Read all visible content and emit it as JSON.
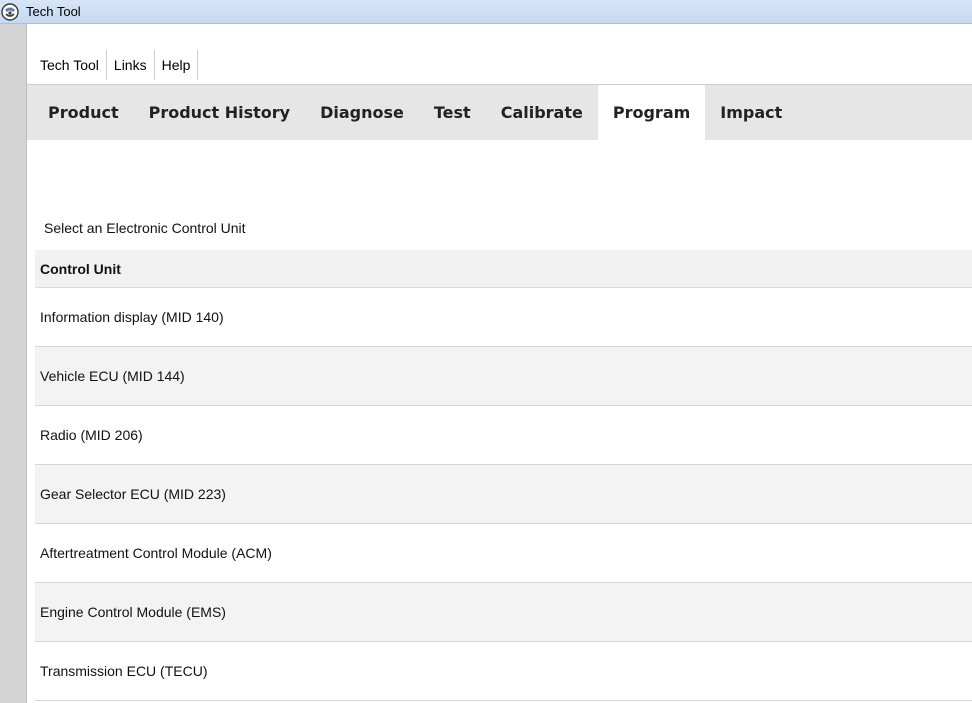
{
  "window": {
    "title": "Tech Tool",
    "icon": "tech-tool-app-icon"
  },
  "menu": {
    "items": [
      {
        "label": "Tech Tool"
      },
      {
        "label": "Links"
      },
      {
        "label": "Help"
      }
    ]
  },
  "nav": {
    "tabs": [
      {
        "label": "Product"
      },
      {
        "label": "Product History"
      },
      {
        "label": "Diagnose"
      },
      {
        "label": "Test"
      },
      {
        "label": "Calibrate"
      },
      {
        "label": "Program",
        "active": true
      },
      {
        "label": "Impact"
      }
    ]
  },
  "content": {
    "prompt": "Select an Electronic Control Unit",
    "table": {
      "header": "Control Unit",
      "rows": [
        "Information display (MID 140)",
        "Vehicle ECU (MID 144)",
        "Radio (MID 206)",
        "Gear Selector ECU (MID 223)",
        "Aftertreatment Control Module (ACM)",
        "Engine Control Module (EMS)",
        "Transmission ECU (TECU)"
      ]
    }
  },
  "colors": {
    "titlebar": "#c4d9f1",
    "navbar": "#e6e6e6",
    "active_tab": "#ffffff",
    "alt_row": "#f3f3f3"
  }
}
